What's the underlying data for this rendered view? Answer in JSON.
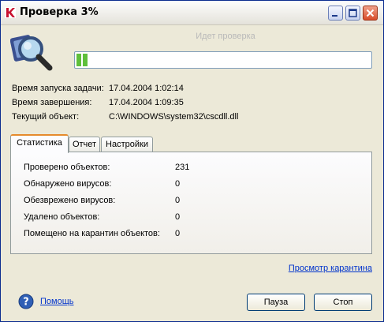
{
  "window": {
    "title": "Проверка 3%"
  },
  "scan": {
    "status": "Идет проверка",
    "progress": 0.03
  },
  "info": [
    {
      "label": "Время запуска задачи:",
      "value": "17.04.2004 1:02:14"
    },
    {
      "label": "Время завершения:",
      "value": "17.04.2004 1:09:35"
    },
    {
      "label": "Текущий объект:",
      "value": "C:\\WINDOWS\\system32\\cscdll.dll"
    }
  ],
  "tabs": [
    {
      "label": "Статистика",
      "active": true
    },
    {
      "label": "Отчет",
      "active": false
    },
    {
      "label": "Настройки",
      "active": false
    }
  ],
  "stats": [
    {
      "label": "Проверено объектов:",
      "value": "231"
    },
    {
      "label": "Обнаружено вирусов:",
      "value": "0"
    },
    {
      "label": "Обезврежено вирусов:",
      "value": "0"
    },
    {
      "label": "Удалено объектов:",
      "value": "0"
    },
    {
      "label": "Помещено на карантин объектов:",
      "value": "0"
    }
  ],
  "links": {
    "quarantine": "Просмотр карантина",
    "help": "Помощь"
  },
  "buttons": {
    "pause": "Пауза",
    "stop": "Стоп"
  },
  "icons": {
    "app": "kaspersky-k-icon",
    "scan": "magnifier-scan-icon",
    "help": "help-question-icon"
  },
  "colors": {
    "accent": "#e68b2c",
    "progress": "#5fbf3b",
    "link": "#0033cc"
  }
}
